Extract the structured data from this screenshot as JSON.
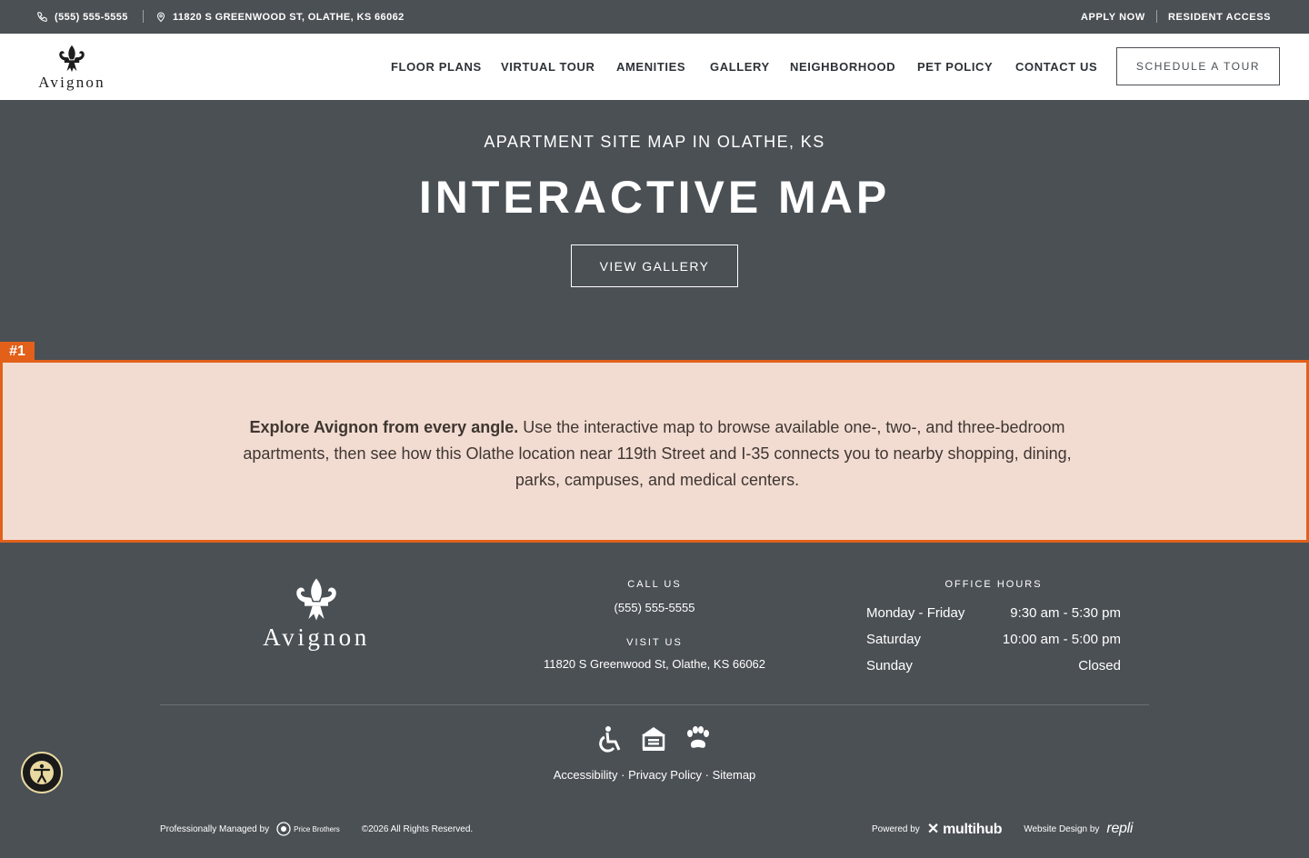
{
  "topbar": {
    "phone": "(555) 555-5555",
    "address": "11820 S GREENWOOD ST, OLATHE, KS 66062",
    "apply": "APPLY NOW",
    "resident": "RESIDENT ACCESS"
  },
  "header": {
    "logo_text": "Avignon",
    "nav": [
      "FLOOR PLANS",
      "VIRTUAL TOUR",
      "AMENITIES",
      "GALLERY",
      "NEIGHBORHOOD",
      "PET POLICY",
      "CONTACT US"
    ],
    "cta": "SCHEDULE A TOUR"
  },
  "hero": {
    "eyebrow": "APARTMENT SITE MAP IN OLATHE, KS",
    "title": "INTERACTIVE MAP",
    "button": "VIEW GALLERY"
  },
  "intro": {
    "tag": "#1",
    "lead": "Explore Avignon from every angle.",
    "body": " Use the interactive map to browse available one-, two-, and three-bedroom apartments, then see how this Olathe location near 119th Street and I-35 connects you to nearby shopping, dining, parks, campuses, and medical centers."
  },
  "footer": {
    "logo_text": "Avignon",
    "call_label": "CALL US",
    "call_value": "(555) 555-5555",
    "visit_label": "VISIT US",
    "visit_value": "11820 S Greenwood St, Olathe, KS 66062",
    "hours_label": "OFFICE HOURS",
    "hours": [
      {
        "day": "Monday - Friday",
        "time": "9:30 am - 5:30 pm"
      },
      {
        "day": "Saturday",
        "time": "10:00 am - 5:00 pm"
      },
      {
        "day": "Sunday",
        "time": "Closed"
      }
    ],
    "links": {
      "accessibility": "Accessibility",
      "privacy": "Privacy Policy",
      "sitemap": "Sitemap",
      "sep": "·"
    },
    "managed_by": "Professionally Managed by",
    "manager": "Price Brothers",
    "copyright": "©2026 All Rights Reserved.",
    "powered_by": "Powered by",
    "powered_brand": "multihub",
    "design_by": "Website Design by",
    "design_brand": "repli"
  },
  "colors": {
    "dark": "#4b5055",
    "accent": "#e2601a",
    "highlight": "#f2dcd2"
  }
}
